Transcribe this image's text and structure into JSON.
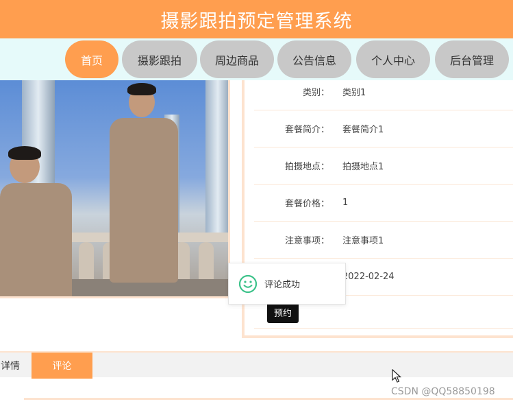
{
  "header": {
    "title": "摄影跟拍预定管理系统"
  },
  "nav": {
    "items": [
      {
        "label": "首页"
      },
      {
        "label": "摄影跟拍"
      },
      {
        "label": "周边商品"
      },
      {
        "label": "公告信息"
      },
      {
        "label": "个人中心"
      },
      {
        "label": "后台管理"
      }
    ]
  },
  "details": {
    "rows": [
      {
        "label": "类别：",
        "value": "类别1"
      },
      {
        "label": "套餐简介：",
        "value": "套餐简介1"
      },
      {
        "label": "拍摄地点：",
        "value": "拍摄地点1"
      },
      {
        "label": "套餐价格：",
        "value": "1"
      },
      {
        "label": "注意事项：",
        "value": "注意事项1"
      },
      {
        "label": "",
        "value": "2022-02-24"
      }
    ],
    "book_label": "预约"
  },
  "toast": {
    "text": "评论成功",
    "icon": "smile-icon"
  },
  "tabs": [
    {
      "label": "详情"
    },
    {
      "label": "评论"
    }
  ],
  "watermark": "CSDN @QQ58850198",
  "colors": {
    "accent": "#ff9e4f",
    "nav_bg": "#e6fafa",
    "nav_item": "#c8c8c8",
    "toast_icon": "#3cc28a"
  }
}
